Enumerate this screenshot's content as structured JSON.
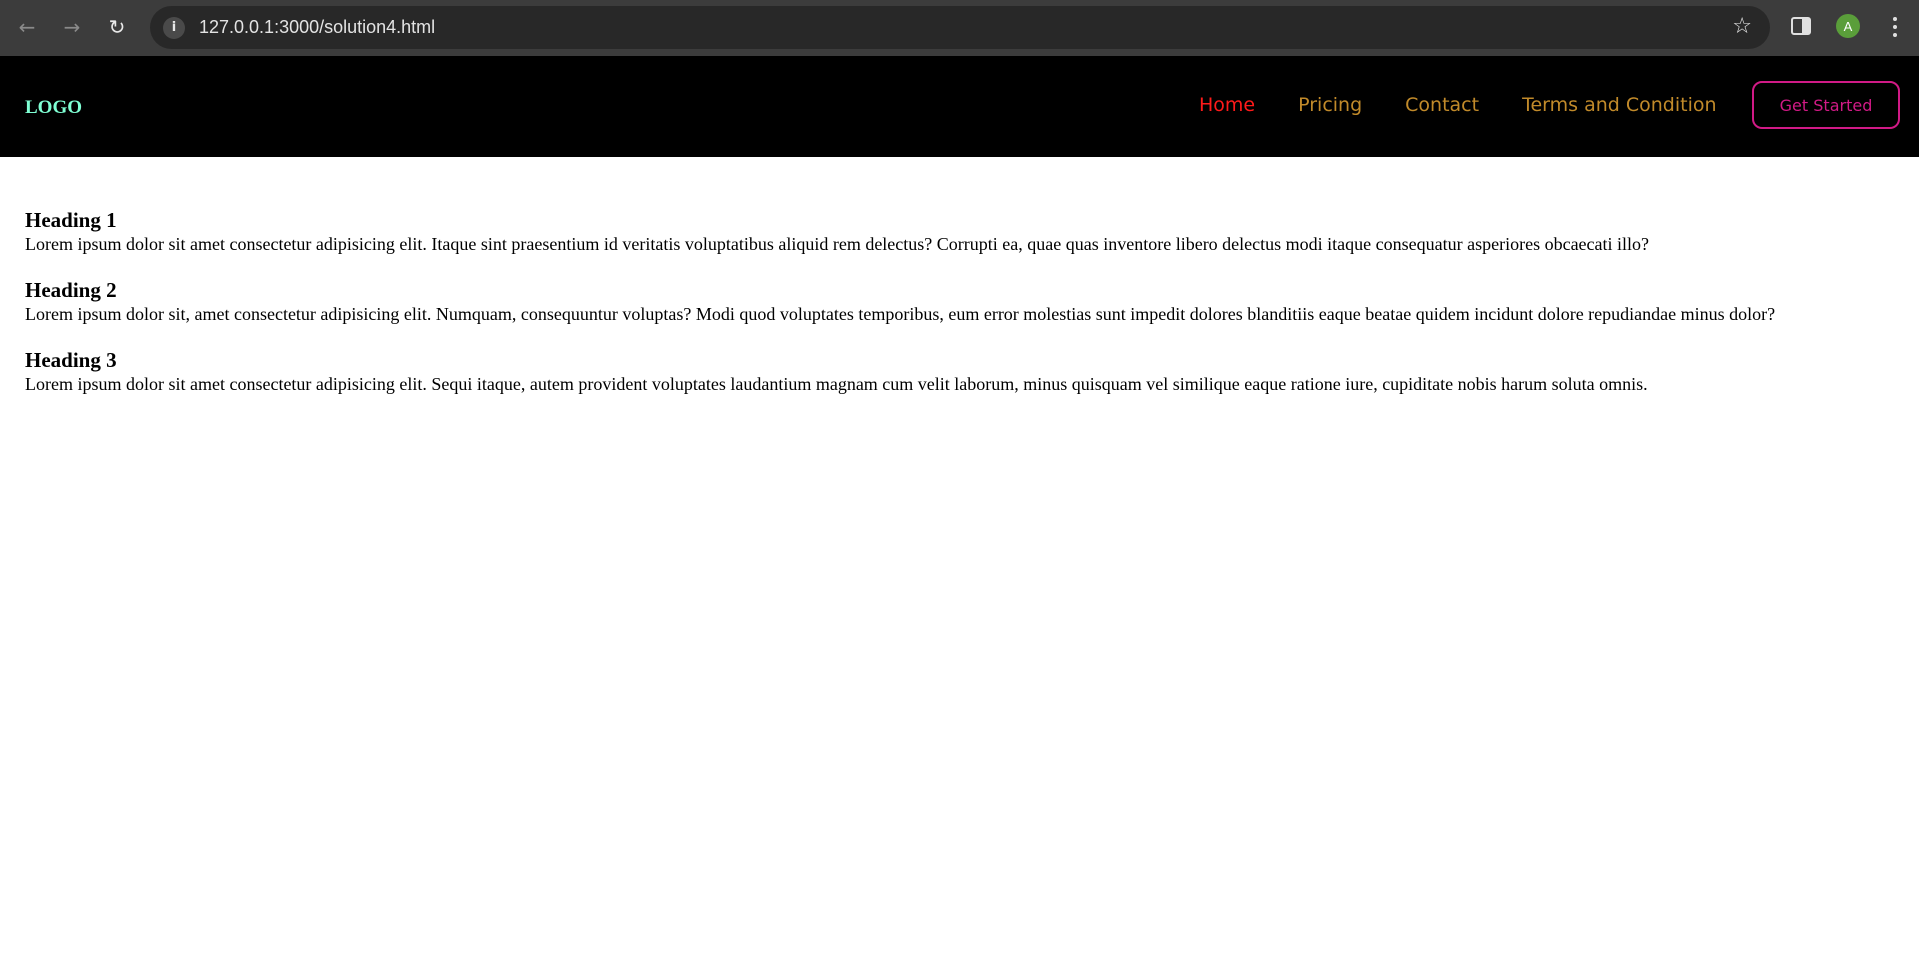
{
  "browser": {
    "url": "127.0.0.1:3000/solution4.html",
    "profile_initial": "A",
    "icons": {
      "back": "arrow-left-icon",
      "forward": "arrow-right-icon",
      "reload": "reload-icon",
      "site_info": "info-icon",
      "bookmark": "star-icon",
      "side_panel": "side-panel-icon",
      "menu": "kebab-menu-icon"
    }
  },
  "navbar": {
    "logo": "LOGO",
    "links": [
      {
        "label": "Home",
        "color": "#ff1a1a"
      },
      {
        "label": "Pricing",
        "color": "#c18a2a"
      },
      {
        "label": "Contact",
        "color": "#c18a2a"
      },
      {
        "label": "Terms and Condition",
        "color": "#c18a2a"
      }
    ],
    "cta_label": "Get Started",
    "cta_color": "#d11a86",
    "logo_color": "#7fffd4"
  },
  "sections": [
    {
      "heading": "Heading 1",
      "text": "Lorem ipsum dolor sit amet consectetur adipisicing elit. Itaque sint praesentium id veritatis voluptatibus aliquid rem delectus? Corrupti ea, quae quas inventore libero delectus modi itaque consequatur asperiores obcaecati illo?"
    },
    {
      "heading": "Heading 2",
      "text": "Lorem ipsum dolor sit, amet consectetur adipisicing elit. Numquam, consequuntur voluptas? Modi quod voluptates temporibus, eum error molestias sunt impedit dolores blanditiis eaque beatae quidem incidunt dolore repudiandae minus dolor?"
    },
    {
      "heading": "Heading 3",
      "text": "Lorem ipsum dolor sit amet consectetur adipisicing elit. Sequi itaque, autem provident voluptates laudantium magnam cum velit laborum, minus quisquam vel similique eaque ratione iure, cupiditate nobis harum soluta omnis."
    }
  ]
}
